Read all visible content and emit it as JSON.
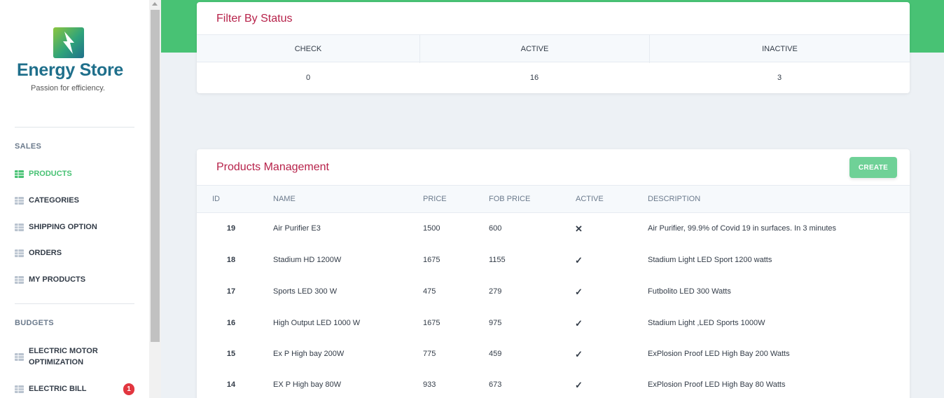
{
  "brand": {
    "name": "Energy Store",
    "tagline": "Passion for efficiency."
  },
  "sidebar": {
    "sections": [
      {
        "label": "SALES",
        "items": [
          {
            "label": "PRODUCTS",
            "active": true
          },
          {
            "label": "CATEGORIES",
            "active": false
          },
          {
            "label": "SHIPPING OPTION",
            "active": false
          },
          {
            "label": "ORDERS",
            "active": false
          },
          {
            "label": "MY PRODUCTS",
            "active": false
          }
        ]
      },
      {
        "label": "BUDGETS",
        "items": [
          {
            "label_line1": "ELECTRIC MOTOR",
            "label_line2": "OPTIMIZATION",
            "active": false
          },
          {
            "label": "ELECTRIC BILL",
            "active": false,
            "badge": "1"
          }
        ]
      }
    ]
  },
  "status_filter": {
    "title": "Filter By Status",
    "columns": [
      "CHECK",
      "ACTIVE",
      "INACTIVE"
    ],
    "values": [
      "0",
      "16",
      "3"
    ]
  },
  "products": {
    "title": "Products Management",
    "create_label": "CREATE",
    "columns": [
      "ID",
      "NAME",
      "PRICE",
      "FOB PRICE",
      "ACTIVE",
      "DESCRIPTION"
    ],
    "rows": [
      {
        "id": "19",
        "name": "Air Purifier E3",
        "price": "1500",
        "fob_price": "600",
        "active": "✕",
        "description": "Air Purifier, 99.9% of Covid 19 in surfaces. In 3 minutes"
      },
      {
        "id": "18",
        "name": "Stadium HD 1200W",
        "price": "1675",
        "fob_price": "1155",
        "active": "✓",
        "description": "Stadium Light LED Sport 1200 watts"
      },
      {
        "id": "17",
        "name": "Sports LED 300 W",
        "price": "475",
        "fob_price": "279",
        "active": "✓",
        "description": "Futbolito LED 300 Watts"
      },
      {
        "id": "16",
        "name": "High Output LED 1000 W",
        "price": "1675",
        "fob_price": "975",
        "active": "✓",
        "description": "Stadium Light ,LED Sports 1000W"
      },
      {
        "id": "15",
        "name": "Ex P High bay 200W",
        "price": "775",
        "fob_price": "459",
        "active": "✓",
        "description": "ExPlosion Proof LED High Bay 200 Watts"
      },
      {
        "id": "14",
        "name": "EX P High bay 80W",
        "price": "933",
        "fob_price": "673",
        "active": "✓",
        "description": "ExPlosion Proof LED High Bay 80 Watts"
      }
    ]
  },
  "colors": {
    "accent_green": "#48c274",
    "title_red": "#b7224a",
    "badge_red": "#e2363f",
    "create_button": "#6fd197"
  },
  "icons": {
    "nav": "table-grid-icon",
    "inactive": "x-mark-icon",
    "active": "check-mark-icon"
  }
}
